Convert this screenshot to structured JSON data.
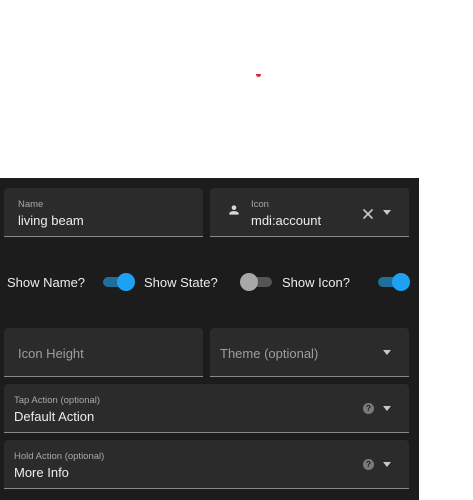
{
  "form": {
    "name": {
      "label": "Name",
      "value": "living beam"
    },
    "icon": {
      "label": "Icon",
      "value": "mdi:account",
      "icon": "account-icon",
      "clear_icon": "close-icon"
    },
    "toggles": {
      "show_name": {
        "label": "Show Name?",
        "on": true
      },
      "show_state": {
        "label": "Show State?",
        "on": false
      },
      "show_icon": {
        "label": "Show Icon?",
        "on": true
      }
    },
    "icon_height": {
      "placeholder": "Icon Height"
    },
    "theme": {
      "placeholder": "Theme (optional)"
    },
    "tap_action": {
      "label": "Tap Action (optional)",
      "value": "Default Action"
    },
    "hold_action": {
      "label": "Hold Action (optional)",
      "value": "More Info"
    },
    "help_glyph": "?"
  },
  "colors": {
    "accent": "#1ea1f3",
    "panel_bg": "#1c1c1c",
    "field_bg": "#2b2b2b",
    "loader_red": "#d32f2f"
  }
}
